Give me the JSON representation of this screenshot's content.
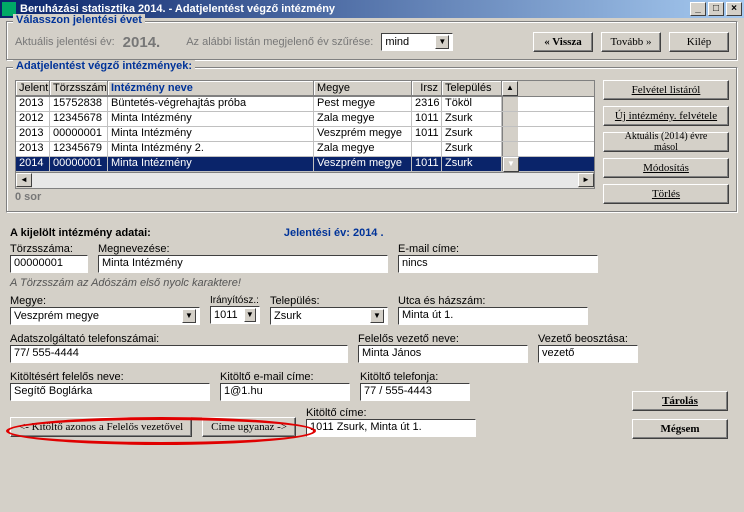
{
  "titlebar": {
    "title": "Beruházási statisztika 2014. - Adatjelentést végző intézmény",
    "min": "_",
    "max": "□",
    "close": "×"
  },
  "g1": {
    "title": "Válasszon jelentési évet",
    "lbl_current": "Aktuális jelentési év:",
    "year": "2014.",
    "lbl_filter": "Az alábbi listán megjelenő év szűrése:",
    "filter_value": "mind",
    "btn_back": "« Vissza",
    "btn_next": "Tovább »",
    "btn_exit": "Kilép"
  },
  "g2": {
    "title": "Adatjelentést végző intézmények:",
    "headers": {
      "c1": "Jelent",
      "c2": "Törzsszám",
      "c3": "Intézmény neve",
      "c4": "Megye",
      "c5": "Irsz",
      "c6": "Település"
    },
    "rows": [
      {
        "c1": "2013",
        "c2": "15752838",
        "c3": "Büntetés-végrehajtás próba",
        "c4": "Pest megye",
        "c5": "2316",
        "c6": "Tököl"
      },
      {
        "c1": "2012",
        "c2": "12345678",
        "c3": "Minta Intézmény",
        "c4": "Zala megye",
        "c5": "1011",
        "c6": "Zsurk"
      },
      {
        "c1": "2013",
        "c2": "00000001",
        "c3": "Minta Intézmény",
        "c4": "Veszprém megye",
        "c5": "1011",
        "c6": "Zsurk"
      },
      {
        "c1": "2013",
        "c2": "12345679",
        "c3": "Minta Intézmény 2.",
        "c4": "Zala megye",
        "c5": "",
        "c6": "Zsurk"
      },
      {
        "c1": "2014",
        "c2": "00000001",
        "c3": "Minta Intézmény",
        "c4": "Veszprém megye",
        "c5": "1011",
        "c6": "Zsurk"
      }
    ],
    "selected_index": 4,
    "count": "0 sor",
    "side": {
      "b1": "Felvétel listáról",
      "b2": "Új intézmény. felvétele",
      "b3": "Aktuális (2014) évre másol",
      "b4": "Módosítás",
      "b5": "Törlés"
    }
  },
  "details": {
    "header_left": "A kijelölt intézmény adatai:",
    "header_right": "Jelentési év:  2014 .",
    "labels": {
      "torzs": "Törzsszáma:",
      "megnev": "Megnevezése:",
      "email": "E-mail címe:",
      "megye": "Megye:",
      "irsz": "Irányítósz.:",
      "telep": "Település:",
      "utca": "Utca és házszám:",
      "adatszolg": "Adatszolgáltató telefonszámai:",
      "felelos": "Felelős vezető neve:",
      "vezbeo": "Vezető beosztása:",
      "kitfel": "Kitöltésért felelős neve:",
      "kitemail": "Kitöltő e-mail címe:",
      "kittel": "Kitöltő telefonja:",
      "kitcim": "Kitöltő címe:"
    },
    "values": {
      "torzs": "00000001",
      "megnev": "Minta Intézmény",
      "email": "nincs",
      "megye": "Veszprém megye",
      "irsz": "1011",
      "telep": "Zsurk",
      "utca": "Minta út 1.",
      "adatszolg": "77/ 555-4444",
      "felelos": "Minta János",
      "vezbeo": "vezető",
      "kitfel": "Segítő Boglárka",
      "kitemail": "1@1.hu",
      "kittel": "77 / 555-4443",
      "kitcim": "1011 Zsurk, Minta út 1."
    },
    "note": "A Törzsszám az Adószám első nyolc karaktere!",
    "btn_same_person": "<- Kitöltő azonos a Felelős vezetővel",
    "btn_same_addr": "Címe ugyanaz ->",
    "btn_store": "Tárolás",
    "btn_cancel": "Mégsem"
  }
}
